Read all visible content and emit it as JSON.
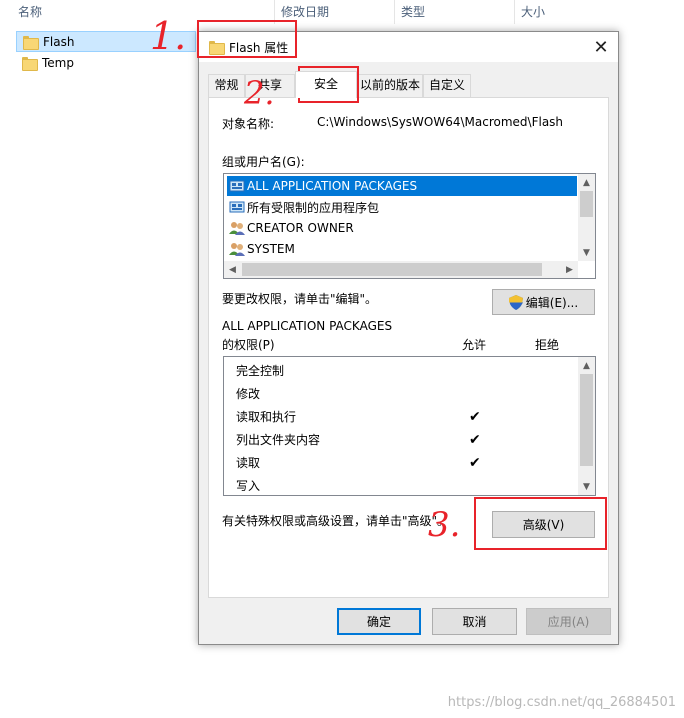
{
  "explorer": {
    "columns": [
      "名称",
      "修改日期",
      "类型",
      "大小"
    ],
    "files": [
      {
        "name": "Flash",
        "selected": true
      },
      {
        "name": "Temp",
        "selected": false
      }
    ]
  },
  "dialog": {
    "title": "Flash 属性",
    "close_glyph": "✕",
    "tabs": [
      "常规",
      "共享",
      "安全",
      "以前的版本",
      "自定义"
    ],
    "active_tab": "安全",
    "object_label": "对象名称:",
    "object_value": "C:\\Windows\\SysWOW64\\Macromed\\Flash",
    "group_label": "组或用户名(G):",
    "users": [
      {
        "name": "ALL APPLICATION PACKAGES",
        "icon": "app-packages-icon",
        "selected": true
      },
      {
        "name": "所有受限制的应用程序包",
        "icon": "restricted-packages-icon",
        "selected": false
      },
      {
        "name": "CREATOR OWNER",
        "icon": "user-group-icon",
        "selected": false
      },
      {
        "name": "SYSTEM",
        "icon": "user-group-icon",
        "selected": false
      }
    ],
    "edit_hint": "要更改权限，请单击\"编辑\"。",
    "edit_button": "编辑(E)...",
    "perm_owner": "ALL APPLICATION PACKAGES",
    "perm_label": "的权限(P)",
    "allow_col": "允许",
    "deny_col": "拒绝",
    "permissions": [
      {
        "name": "完全控制",
        "allow": false
      },
      {
        "name": "修改",
        "allow": false
      },
      {
        "name": "读取和执行",
        "allow": true
      },
      {
        "name": "列出文件夹内容",
        "allow": true
      },
      {
        "name": "读取",
        "allow": true
      },
      {
        "name": "写入",
        "allow": false
      }
    ],
    "check_glyph": "✔",
    "advanced_hint": "有关特殊权限或高级设置，请单击\"高级\"。",
    "advanced_button": "高级(V)",
    "ok_button": "确定",
    "cancel_button": "取消",
    "apply_button": "应用(A)"
  },
  "annotations": [
    "1.",
    "2.",
    "3."
  ],
  "watermark": "https://blog.csdn.net/qq_26884501",
  "colors": {
    "accent": "#0078d7",
    "annotation": "#e8232a",
    "selection": "#cce8ff"
  }
}
